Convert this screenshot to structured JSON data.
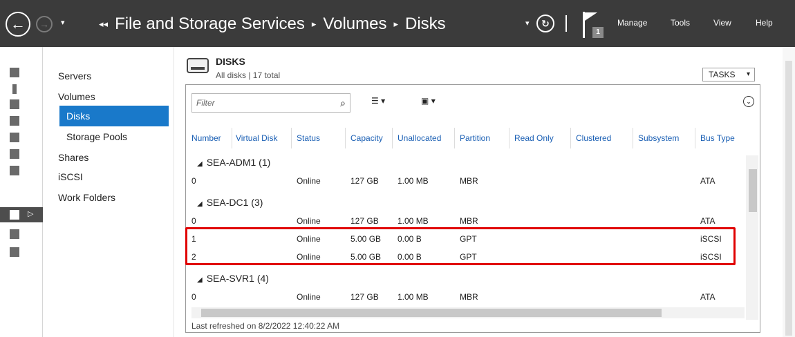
{
  "topbar": {
    "back_label": "←",
    "forward_label": "→",
    "dropdown_glyph": "▾",
    "breadcrumb_lead": "◂◂",
    "breadcrumb": [
      "File and Storage Services",
      "Volumes",
      "Disks"
    ],
    "breadcrumb_sep": "▸",
    "refresh_glyph": "↻",
    "notification_count": "1",
    "menu": [
      "Manage",
      "Tools",
      "View",
      "Help"
    ]
  },
  "sidebar": {
    "items": [
      {
        "label": "Servers"
      },
      {
        "label": "Volumes"
      },
      {
        "label": "Disks"
      },
      {
        "label": "Storage Pools"
      },
      {
        "label": "Shares"
      },
      {
        "label": "iSCSI"
      },
      {
        "label": "Work Folders"
      }
    ],
    "selected": "Disks"
  },
  "section": {
    "title": "DISKS",
    "subtitle": "All disks | 17 total",
    "tasks_label": "TASKS"
  },
  "filter": {
    "placeholder": "Filter",
    "search_glyph": "⌕",
    "list_glyph": "☰",
    "save_glyph": "▣",
    "caret": "▾",
    "expand_glyph": "⌄"
  },
  "table": {
    "columns": [
      "Number",
      "Virtual Disk",
      "Status",
      "Capacity",
      "Unallocated",
      "Partition",
      "Read Only",
      "Clustered",
      "Subsystem",
      "Bus Type"
    ],
    "groups": [
      {
        "name": "SEA-ADM1 (1)",
        "rows": [
          {
            "number": "0",
            "status": "Online",
            "capacity": "127 GB",
            "unallocated": "1.00 MB",
            "partition": "MBR",
            "bus": "ATA"
          }
        ]
      },
      {
        "name": "SEA-DC1 (3)",
        "rows": [
          {
            "number": "0",
            "status": "Online",
            "capacity": "127 GB",
            "unallocated": "1.00 MB",
            "partition": "MBR",
            "bus": "ATA"
          },
          {
            "number": "1",
            "status": "Online",
            "capacity": "5.00 GB",
            "unallocated": "0.00 B",
            "partition": "GPT",
            "bus": "iSCSI"
          },
          {
            "number": "2",
            "status": "Online",
            "capacity": "5.00 GB",
            "unallocated": "0.00 B",
            "partition": "GPT",
            "bus": "iSCSI"
          }
        ]
      },
      {
        "name": "SEA-SVR1 (4)",
        "rows": [
          {
            "number": "0",
            "status": "Online",
            "capacity": "127 GB",
            "unallocated": "1.00 MB",
            "partition": "MBR",
            "bus": "ATA"
          }
        ]
      }
    ],
    "group_toggle": "◢"
  },
  "footer": {
    "last_refreshed": "Last refreshed on 8/2/2022 12:40:22 AM"
  },
  "colors": {
    "topbar": "#3b3b3b",
    "selection": "#1979ca",
    "header_link": "#1a5fb4",
    "highlight": "#e00000"
  }
}
